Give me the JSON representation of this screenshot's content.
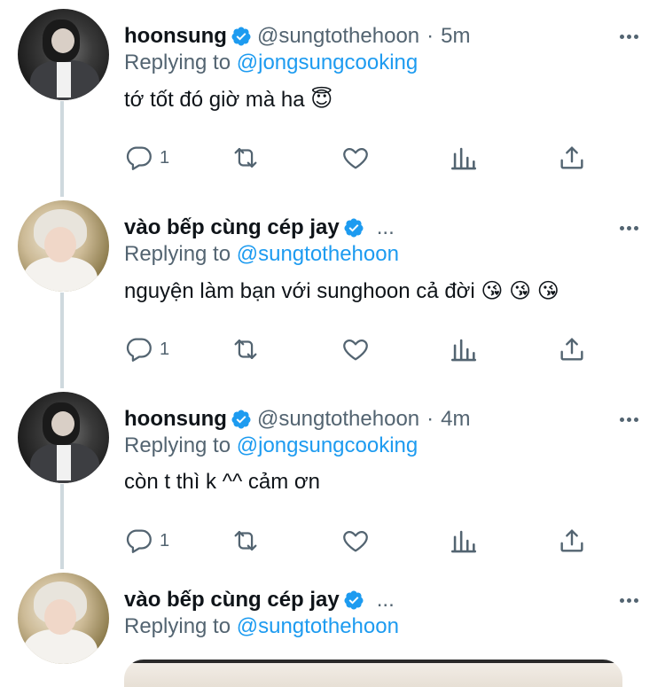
{
  "colors": {
    "link": "#1d9bf0",
    "secondary": "#536471",
    "verified": "#1d9bf0",
    "thread_line": "#cfd9de"
  },
  "tweets": [
    {
      "name": "hoonsung",
      "handle": "@sungtothehoon",
      "separator": "·",
      "time": "5m",
      "replying_prefix": "Replying to",
      "replying_to": "@jongsungcooking",
      "text": "tớ tốt đó giờ mà ha 😇",
      "reply_count": "1",
      "avatar": "dark-suit-avatar"
    },
    {
      "name": "vào bếp cùng cép jay",
      "ellipsis": "...",
      "replying_prefix": "Replying to",
      "replying_to": "@sungtothehoon",
      "text": "nguyện làm bạn với sunghoon cả đời 😘 😘 😘",
      "reply_count": "1",
      "avatar": "blonde-avatar"
    },
    {
      "name": "hoonsung",
      "handle": "@sungtothehoon",
      "separator": "·",
      "time": "4m",
      "replying_prefix": "Replying to",
      "replying_to": "@jongsungcooking",
      "text": "còn t thì k ^^ cảm ơn",
      "reply_count": "1",
      "avatar": "dark-suit-avatar"
    },
    {
      "name": "vào bếp cùng cép jay",
      "ellipsis": "...",
      "replying_prefix": "Replying to",
      "replying_to": "@sungtothehoon",
      "avatar": "blonde-avatar",
      "media": "attached-image"
    }
  ],
  "icons": {
    "reply": "reply-icon",
    "retweet": "retweet-icon",
    "like": "heart-icon",
    "analytics": "analytics-icon",
    "share": "share-icon",
    "more": "more-icon",
    "verified": "verified-badge-icon"
  }
}
